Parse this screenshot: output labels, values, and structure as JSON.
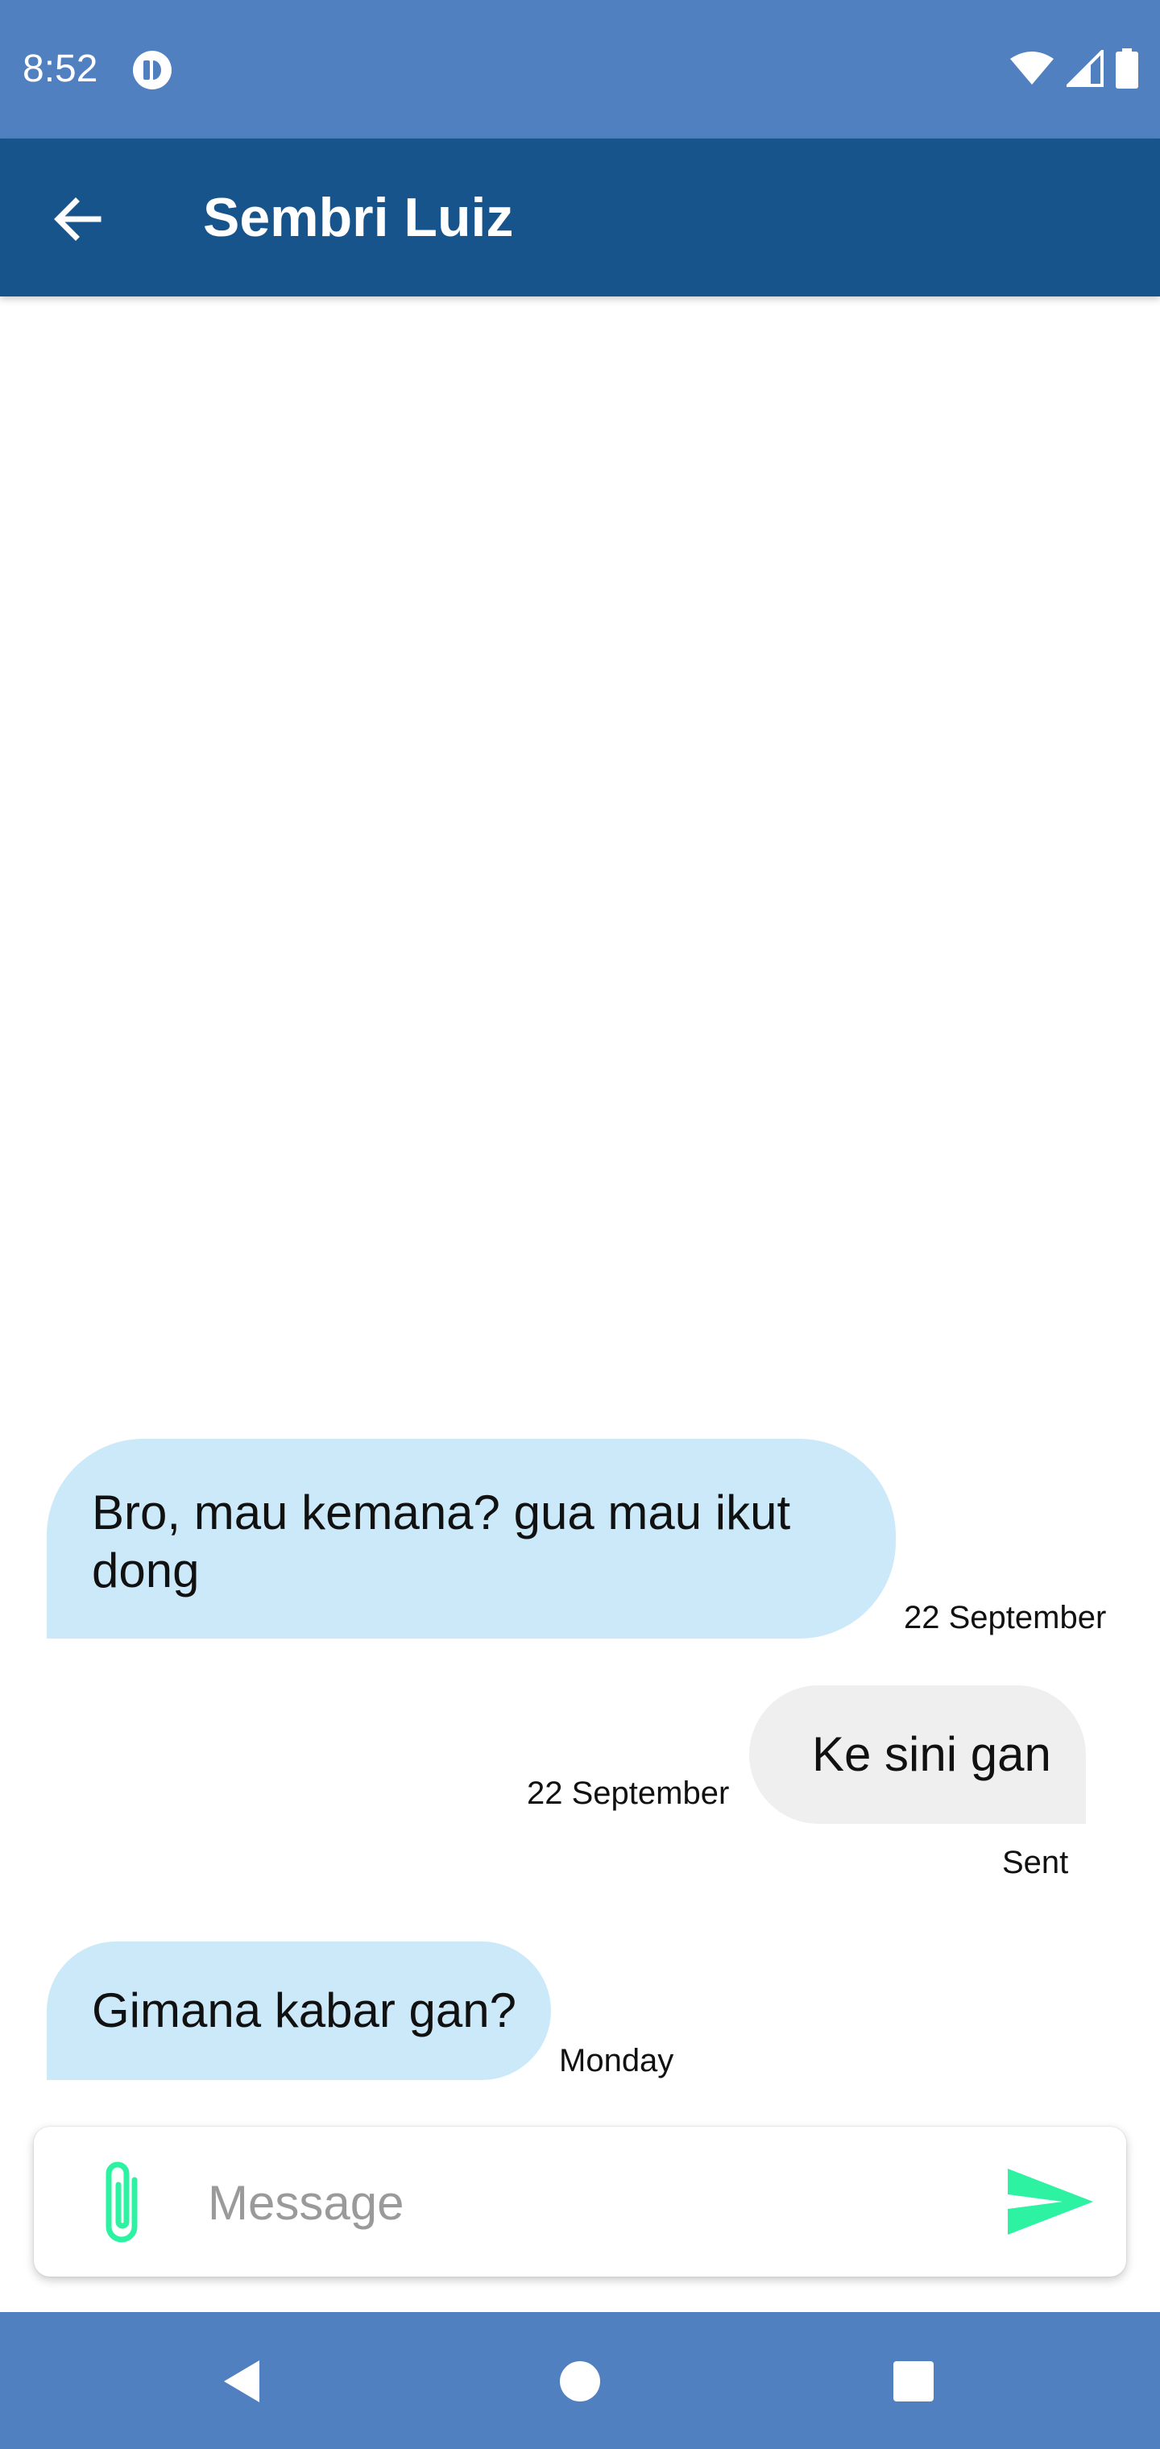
{
  "status_bar": {
    "time": "8:52",
    "icons": [
      "app-notification-icon",
      "wifi-icon",
      "cellular-signal-icon",
      "battery-icon"
    ]
  },
  "app_bar": {
    "title": "Sembri Luiz",
    "back_icon": "arrow-back-icon",
    "color": "#17548b"
  },
  "messages": [
    {
      "direction": "incoming",
      "text_lines": [
        "Bro, mau kemana? gua mau ikut",
        "dong"
      ],
      "time": "22 September"
    },
    {
      "direction": "outgoing",
      "text": "Ke sini gan",
      "time": "22 September",
      "status": "Sent"
    },
    {
      "direction": "incoming",
      "text": "Gimana kabar gan?",
      "time": "Monday"
    }
  ],
  "composer": {
    "placeholder": "Message",
    "value": "",
    "attach_icon": "paperclip-icon",
    "send_icon": "send-icon",
    "accent": "#2cf2a2"
  },
  "nav_bar": {
    "icons": [
      "nav-back-icon",
      "nav-home-icon",
      "nav-recents-icon"
    ]
  },
  "colors": {
    "status_bar": "#5180c0",
    "incoming_bubble": "#cce9fa",
    "outgoing_bubble": "#efefef"
  }
}
